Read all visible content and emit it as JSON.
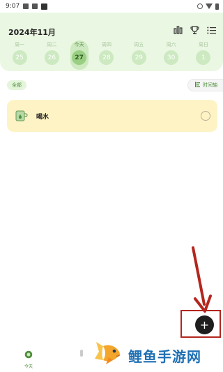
{
  "status_bar": {
    "time": "9:07"
  },
  "header": {
    "month_title": "2024年11月",
    "icons": [
      "bar-chart-icon",
      "trophy-icon",
      "list-icon"
    ]
  },
  "week": [
    {
      "weekday": "周一",
      "date": "25",
      "today": false
    },
    {
      "weekday": "周二",
      "date": "26",
      "today": false
    },
    {
      "weekday": "今天",
      "date": "27",
      "today": true
    },
    {
      "weekday": "周四",
      "date": "28",
      "today": false
    },
    {
      "weekday": "周五",
      "date": "29",
      "today": false
    },
    {
      "weekday": "周六",
      "date": "30",
      "today": false
    },
    {
      "weekday": "周日",
      "date": "1",
      "today": false
    }
  ],
  "filters": {
    "all_label": "全部",
    "timeline_label": "时间轴"
  },
  "tasks": [
    {
      "label": "喝水",
      "icon": "cup-icon",
      "done": false
    }
  ],
  "fab": {
    "label": "+"
  },
  "bottom_nav": {
    "today_label": "今天"
  },
  "watermark": {
    "text": "鲤鱼手游网"
  },
  "colors": {
    "accent_green": "#4d8f3a",
    "header_bg": "#eaf7e2",
    "card_bg": "#fdf3c4",
    "annotation_red": "#b3261e"
  }
}
